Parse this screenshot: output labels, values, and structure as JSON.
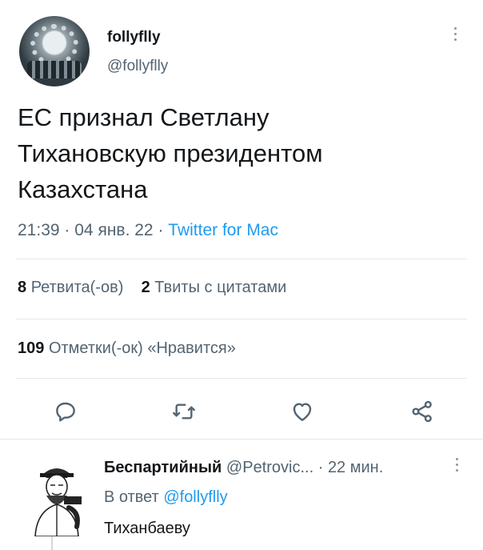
{
  "author": {
    "display_name": "follyflly",
    "handle": "@follyflly"
  },
  "tweet": {
    "lines": [
      "ЕС признал Светлану",
      "Тихановскую президентом",
      "Казахстана"
    ],
    "time": "21:39",
    "date": "04 янв. 22",
    "source": "Twitter for Mac",
    "sep": "·"
  },
  "stats": {
    "retweets_count": "8",
    "retweets_label": "Ретвита(-ов)",
    "quotes_count": "2",
    "quotes_label": "Твиты с цитатами",
    "likes_count": "109",
    "likes_label": "Отметки(-ок) «Нравится»"
  },
  "actions": [
    "reply-icon",
    "retweet-icon",
    "like-icon",
    "share-icon"
  ],
  "reply": {
    "display_name": "Беспартийный",
    "handle": "@Petrovic...",
    "sep": "·",
    "time": "22 мин.",
    "in_reply_prefix": "В ответ",
    "in_reply_mention": "@follyflly",
    "text": "Тиханбаеву"
  },
  "colors": {
    "link": "#1d9bf0",
    "muted": "#536471",
    "text": "#14171a",
    "divider": "#e3e7ea"
  }
}
